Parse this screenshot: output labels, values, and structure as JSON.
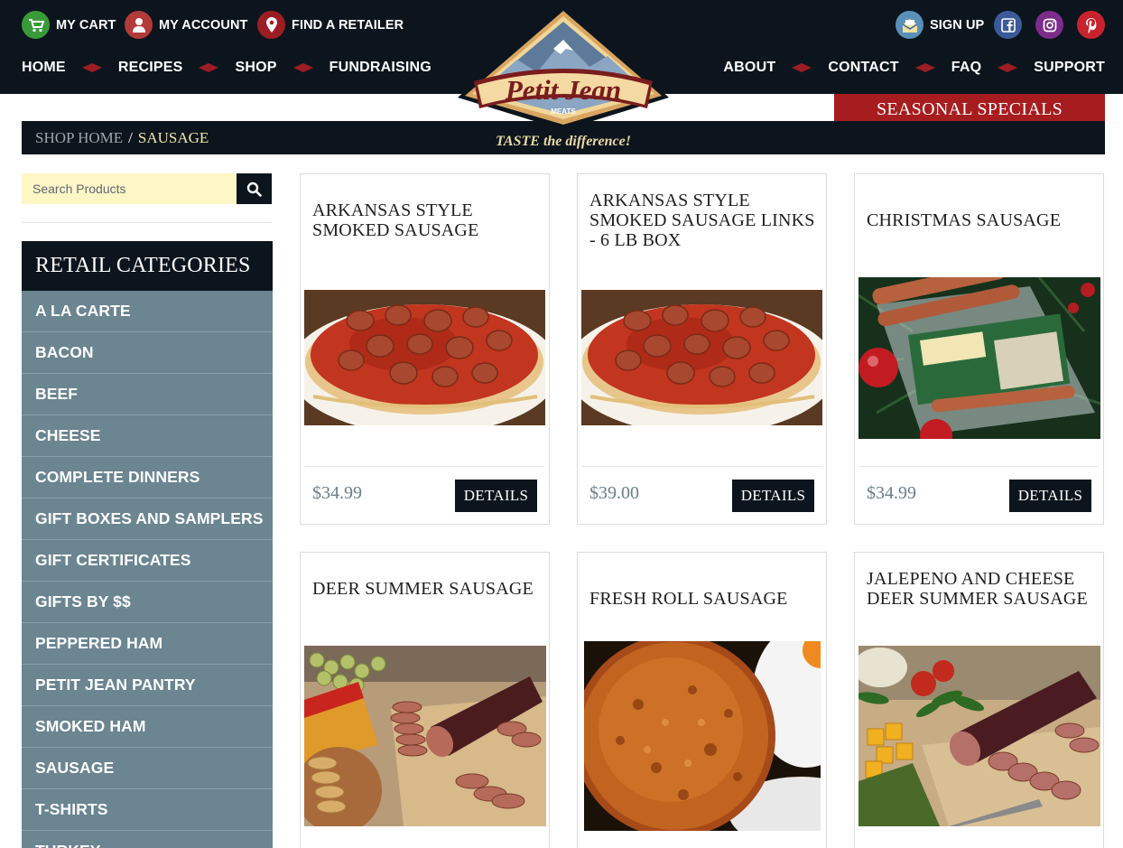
{
  "header": {
    "util_links": [
      {
        "label": "MY CART",
        "icon": "cart-icon",
        "color": "#3a9a3a"
      },
      {
        "label": "MY ACCOUNT",
        "icon": "account-icon",
        "color": "#b33a3a"
      },
      {
        "label": "FIND A RETAILER",
        "icon": "map-pin-icon",
        "color": "#9c1e24"
      }
    ],
    "signup_label": "SIGN UP",
    "social": [
      {
        "name": "facebook",
        "color": "#3b5a9a"
      },
      {
        "name": "instagram",
        "color": "#7d2c8b"
      },
      {
        "name": "pinterest",
        "color": "#c8232c"
      }
    ],
    "nav_left": [
      "HOME",
      "RECIPES",
      "SHOP",
      "FUNDRAISING"
    ],
    "nav_right": [
      "ABOUT",
      "CONTACT",
      "FAQ",
      "SUPPORT"
    ],
    "logo": {
      "name": "Petit Jean",
      "sub": "MEATS"
    },
    "tagline": "TASTE the difference!",
    "seasonal_label": "SEASONAL SPECIALS"
  },
  "breadcrumb": {
    "home": "SHOP HOME",
    "separator": "/",
    "current": "SAUSAGE"
  },
  "search": {
    "placeholder": "Search Products"
  },
  "sidebar": {
    "heading": "RETAIL CATEGORIES",
    "items": [
      "A LA CARTE",
      "BACON",
      "BEEF",
      "CHEESE",
      "COMPLETE DINNERS",
      "GIFT BOXES AND SAMPLERS",
      "GIFT CERTIFICATES",
      "GIFTS BY $$",
      "PEPPERED HAM",
      "PETIT JEAN PANTRY",
      "SMOKED HAM",
      "SAUSAGE",
      "T-SHIRTS",
      "TURKEY"
    ]
  },
  "products": [
    {
      "title": "ARKANSAS STYLE SMOKED SAUSAGE",
      "price": "$34.99",
      "button": "DETAILS",
      "image": "sausage-spaghetti"
    },
    {
      "title": "ARKANSAS STYLE SMOKED SAUSAGE LINKS - 6 LB BOX",
      "price": "$39.00",
      "button": "DETAILS",
      "image": "sausage-spaghetti"
    },
    {
      "title": "CHRISTMAS SAUSAGE",
      "price": "$34.99",
      "button": "DETAILS",
      "image": "christmas-package"
    },
    {
      "title": "DEER SUMMER SAUSAGE",
      "image": "summer-sausage-board"
    },
    {
      "title": "FRESH ROLL SAUSAGE",
      "image": "sausage-patty"
    },
    {
      "title": "JALEPENO AND CHEESE DEER SUMMER SAUSAGE",
      "image": "jalapeno-summer-sausage"
    }
  ],
  "colors": {
    "dark": "#0c151d",
    "slate": "#6b8591",
    "red": "#a71c1e",
    "cream": "#fdf7c6"
  }
}
